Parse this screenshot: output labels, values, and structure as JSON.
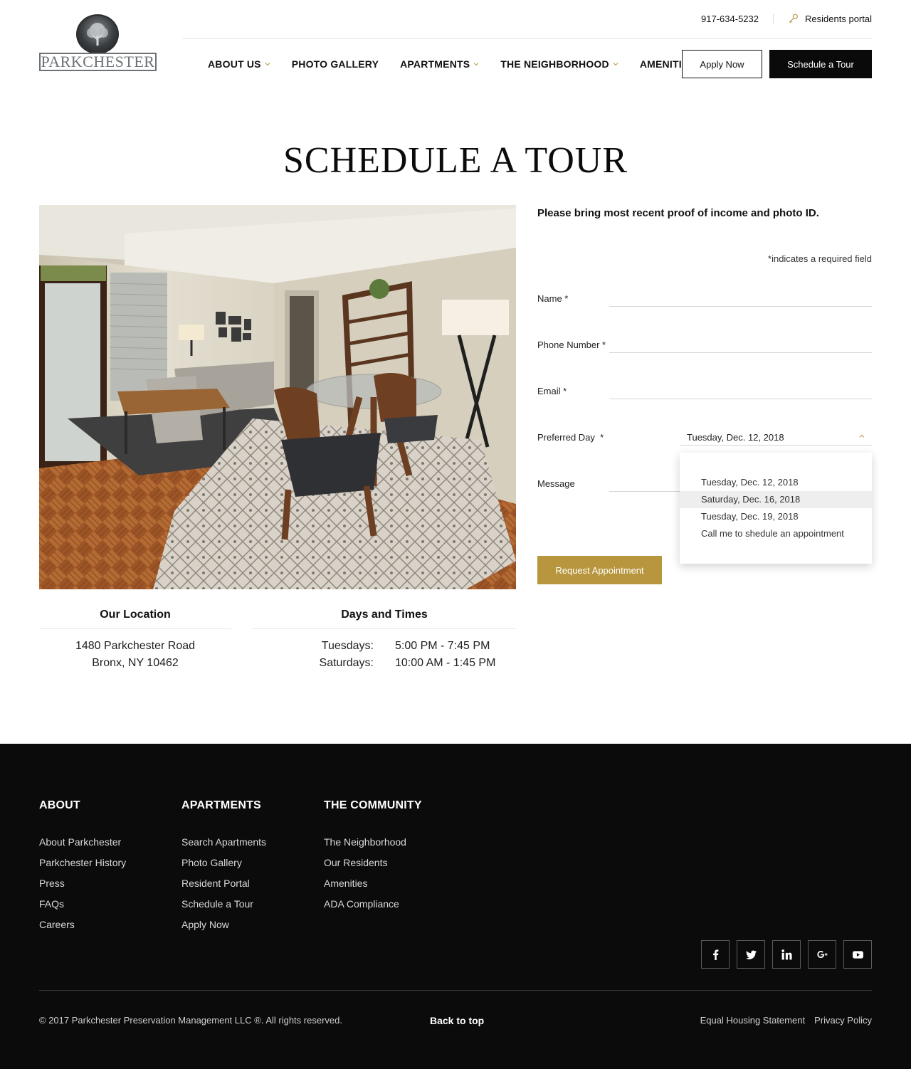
{
  "header": {
    "logo_text": "PARKCHESTER",
    "phone": "917-634-5232",
    "residents_portal": "Residents portal",
    "nav": [
      {
        "label": "ABOUT US",
        "has_dropdown": true
      },
      {
        "label": "PHOTO GALLERY",
        "has_dropdown": false
      },
      {
        "label": "APARTMENTS",
        "has_dropdown": true
      },
      {
        "label": "THE NEIGHBORHOOD",
        "has_dropdown": true
      },
      {
        "label": "AMENITIES",
        "has_dropdown": false
      }
    ],
    "apply_now": "Apply Now",
    "schedule_tour": "Schedule a Tour"
  },
  "page": {
    "title": "SCHEDULE A TOUR"
  },
  "form": {
    "note": "Please bring most recent proof of income and photo ID.",
    "required_note": "*indicates a required field",
    "fields": {
      "name": "Name *",
      "phone": "Phone Number *",
      "email": "Email *",
      "preferred_day": "Preferred Day  *",
      "message": "Message"
    },
    "preferred_day_value": "Tuesday, Dec. 12, 2018",
    "preferred_day_options": [
      "Tuesday, Dec. 12, 2018",
      "Saturday, Dec. 16, 2018",
      "Tuesday, Dec. 19, 2018",
      "Call me to shedule an appointment"
    ],
    "highlighted_option_index": 1,
    "submit": "Request Appointment"
  },
  "location": {
    "heading": "Our Location",
    "line1": "1480 Parkchester Road",
    "line2": "Bronx, NY 10462"
  },
  "hours": {
    "heading": "Days and Times",
    "rows": [
      {
        "day": "Tuesdays:",
        "time": "5:00 PM - 7:45 PM"
      },
      {
        "day": "Saturdays:",
        "time": "10:00 AM - 1:45 PM"
      }
    ]
  },
  "footer": {
    "columns": [
      {
        "heading": "ABOUT",
        "links": [
          "About Parkchester",
          "Parkchester History",
          "Press",
          "FAQs",
          "Careers"
        ]
      },
      {
        "heading": "APARTMENTS",
        "links": [
          "Search Apartments",
          "Photo Gallery",
          "Resident Portal",
          "Schedule a Tour",
          "Apply Now"
        ]
      },
      {
        "heading": "THE COMMUNITY",
        "links": [
          "The Neighborhood",
          "Our Residents",
          "Amenities",
          "ADA Compliance"
        ]
      }
    ],
    "social": [
      "facebook-icon",
      "twitter-icon",
      "linkedin-icon",
      "google-plus-icon",
      "youtube-icon"
    ],
    "copyright": "© 2017 Parkchester Preservation Management LLC ®. All rights reserved.",
    "back_to_top": "Back to top",
    "equal_housing": "Equal Housing Statement",
    "privacy": "Privacy Policy"
  },
  "colors": {
    "accent_gold": "#b8963e",
    "footer_bg": "#0a0b0a",
    "dark_button": "#0a0a0a"
  }
}
